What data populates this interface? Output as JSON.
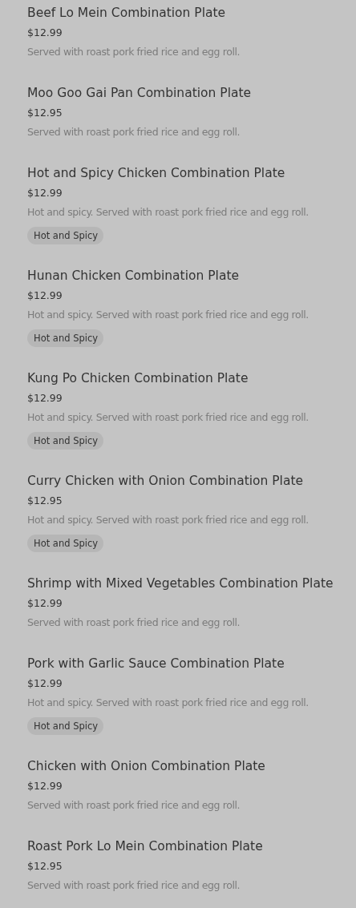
{
  "menu_items": [
    {
      "name": "Beef Lo Mein Combination Plate",
      "price": "$12.99",
      "description": "Served with roast pork fried rice and egg roll."
    },
    {
      "name": "Moo Goo Gai Pan Combination Plate",
      "price": "$12.95",
      "description": "Served with roast pork fried rice and egg roll."
    },
    {
      "name": "Hot and Spicy Chicken Combination Plate",
      "price": "$12.99",
      "description": "Hot and spicy. Served with roast pork fried rice and egg roll.",
      "tags": [
        "Hot and Spicy"
      ]
    },
    {
      "name": "Hunan Chicken Combination Plate",
      "price": "$12.99",
      "description": "Hot and spicy. Served with roast pork fried rice and egg roll.",
      "tags": [
        "Hot and Spicy"
      ]
    },
    {
      "name": "Kung Po Chicken Combination Plate",
      "price": "$12.99",
      "description": "Hot and spicy. Served with roast pork fried rice and egg roll.",
      "tags": [
        "Hot and Spicy"
      ]
    },
    {
      "name": "Curry Chicken with Onion Combination Plate",
      "price": "$12.95",
      "description": "Hot and spicy. Served with roast pork fried rice and egg roll.",
      "tags": [
        "Hot and Spicy"
      ]
    },
    {
      "name": "Shrimp with Mixed Vegetables Combination Plate",
      "price": "$12.99",
      "description": "Served with roast pork fried rice and egg roll."
    },
    {
      "name": "Pork with Garlic Sauce Combination Plate",
      "price": "$12.99",
      "description": "Hot and spicy. Served with roast pork fried rice and egg roll.",
      "tags": [
        "Hot and Spicy"
      ]
    },
    {
      "name": "Chicken with Onion Combination Plate",
      "price": "$12.99",
      "description": "Served with roast pork fried rice and egg roll."
    },
    {
      "name": "Roast Pork Lo Mein Combination Plate",
      "price": "$12.95",
      "description": "Served with roast pork fried rice and egg roll."
    }
  ]
}
